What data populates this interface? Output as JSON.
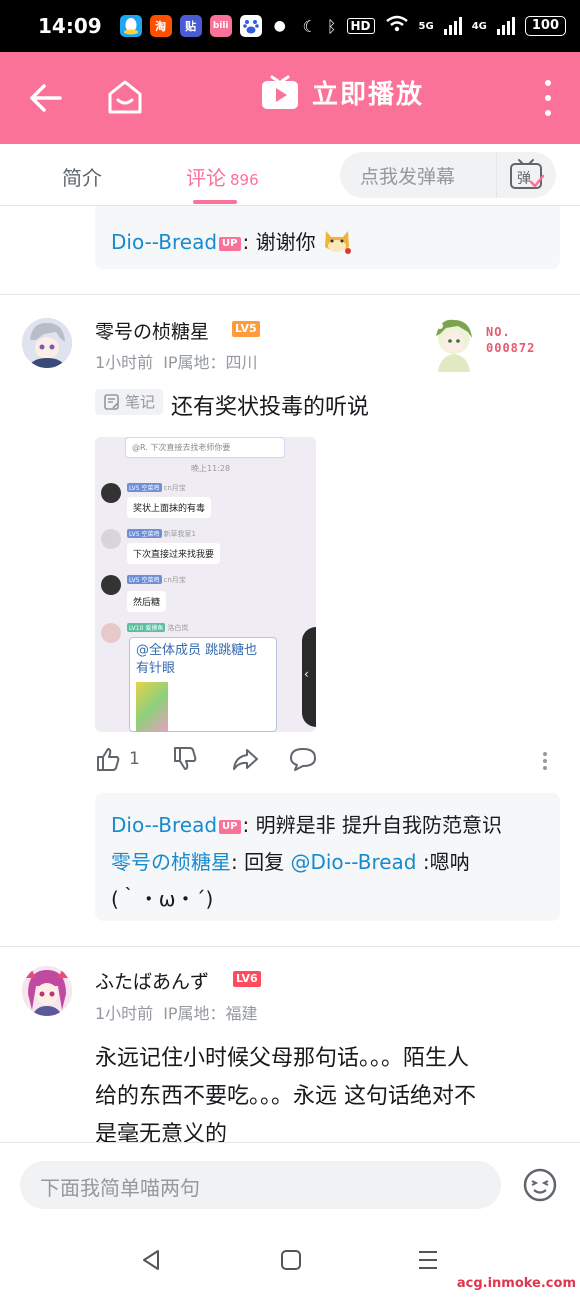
{
  "status_bar": {
    "time": "14:09",
    "apps": [
      {
        "name": "qq-icon",
        "label": "",
        "color": "#1ea7f1"
      },
      {
        "name": "taobao-icon",
        "label": "淘",
        "color": "#ff5000"
      },
      {
        "name": "tieba-icon",
        "label": "贴",
        "color": "#4a5bd4"
      },
      {
        "name": "bilibili-icon",
        "label": "bili",
        "color": "#fb7299"
      },
      {
        "name": "baidu-icon",
        "label": "",
        "color": "#2e5fe0"
      }
    ],
    "hd_label": "HD",
    "net_5g": "5G",
    "net_4g": "4G",
    "battery": "100"
  },
  "header": {
    "title": "立即播放",
    "bg_color": "#fb7299"
  },
  "tabs": {
    "intro": "简介",
    "comments": "评论",
    "comment_count": "896"
  },
  "danmaku": {
    "placeholder": "点我发弹幕",
    "button_label": "弹"
  },
  "top_reply": {
    "user": "Dio--Bread",
    "up_badge": "UP",
    "text": ": 谢谢你"
  },
  "comment1": {
    "username": "零号の桢糖星",
    "level": "LV5",
    "level_color": "#ff9b3a",
    "time": "1小时前",
    "ip": "IP属地：四川",
    "fan_no_label": "NO.",
    "fan_no": "000872",
    "note_label": "笔记",
    "text": "还有奖状投毒的听说",
    "image": {
      "top_text": "@R. 下次直接去找老师你要",
      "time": "晚上11:28",
      "messages": [
        {
          "name": "cn月宝",
          "lv": "LV5 空菜鸡",
          "text": "奖状上面抹的有毒"
        },
        {
          "name": "新草我家1",
          "lv": "LV5 空菜鸡",
          "text": "下次直接过来找我要"
        },
        {
          "name": "cn月宝",
          "lv": "LV5 空菜鸡",
          "text": "然后糖"
        },
        {
          "name": "洛白岚",
          "lv": "LV10 爱摸鱼",
          "text": "@全体成员 跳跳糖也有针眼"
        }
      ]
    },
    "likes": "1",
    "replies": [
      {
        "user": "Dio--Bread",
        "up": "UP",
        "text": ": 明辨是非 提升自我防范意识"
      },
      {
        "user": "零号の桢糖星",
        "mid": ": 回复 ",
        "mention": "@Dio--Bread",
        "text": " :嗯呐"
      },
      {
        "text": "(｀・ω・´)"
      }
    ]
  },
  "comment2": {
    "username": "ふたばあんず",
    "level": "LV6",
    "level_color": "#ff4b5c",
    "time": "1小时前",
    "ip": "IP属地：福建",
    "text_line1": "永远记住小时候父母那句话。。。陌生人",
    "text_line2": "给的东西不要吃。。。永远 这句话绝对不",
    "text_line3": "是毫无意义的"
  },
  "bottom": {
    "placeholder": "下面我简单喵两句"
  },
  "watermark": "acg.inmoke.com"
}
